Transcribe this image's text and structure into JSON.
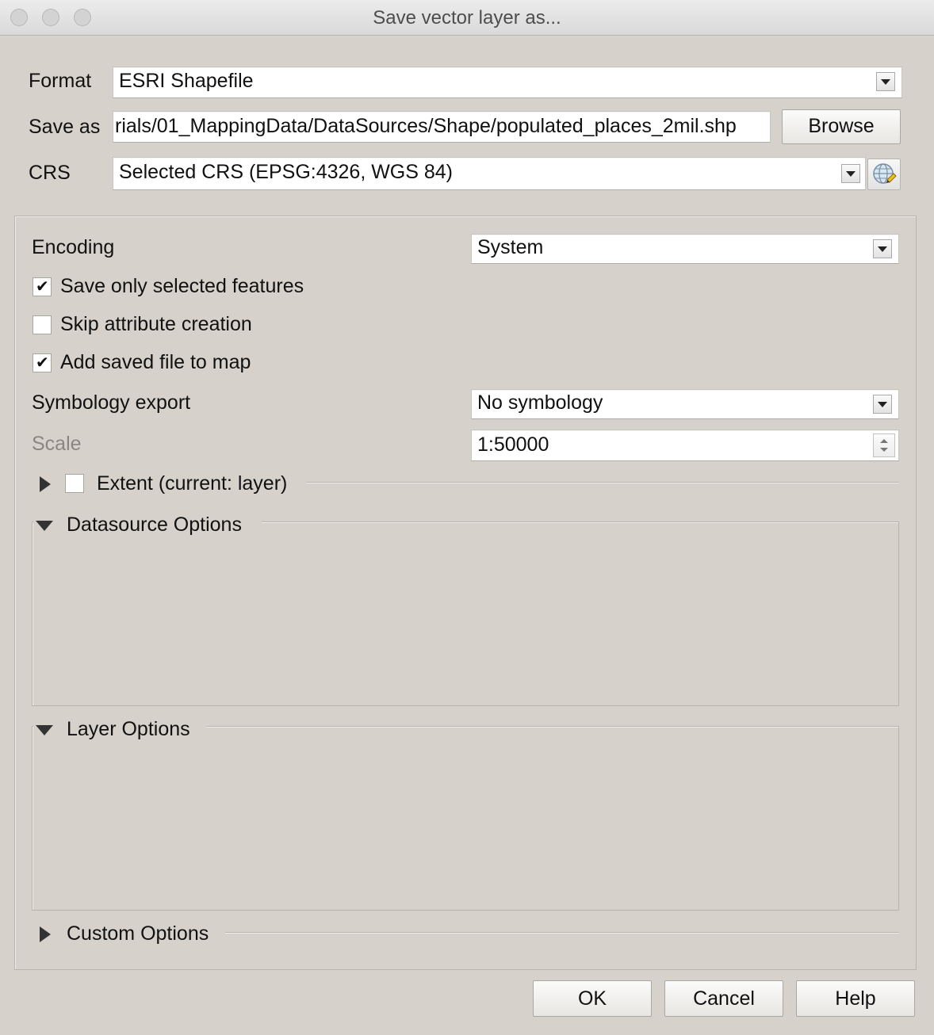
{
  "window": {
    "title": "Save vector layer as..."
  },
  "form": {
    "format_label": "Format",
    "format_value": "ESRI Shapefile",
    "save_as_label": "Save as",
    "save_as_value": "rials/01_MappingData/DataSources/Shape/populated_places_2mil.shp",
    "browse_label": "Browse",
    "crs_label": "CRS",
    "crs_value": "Selected CRS (EPSG:4326, WGS 84)",
    "crs_icon": "globe-select-icon"
  },
  "options": {
    "encoding_label": "Encoding",
    "encoding_value": "System",
    "save_selected_label": "Save only selected features",
    "save_selected_checked": true,
    "skip_attr_label": "Skip attribute creation",
    "skip_attr_checked": false,
    "add_to_map_label": "Add saved file to map",
    "add_to_map_checked": true,
    "symbology_label": "Symbology export",
    "symbology_value": "No symbology",
    "scale_label": "Scale",
    "scale_value": "1:50000",
    "extent_label": "Extent (current: layer)",
    "extent_checked": false,
    "datasource_label": "Datasource Options",
    "layer_label": "Layer Options",
    "custom_label": "Custom Options"
  },
  "buttons": {
    "ok": "OK",
    "cancel": "Cancel",
    "help": "Help"
  }
}
